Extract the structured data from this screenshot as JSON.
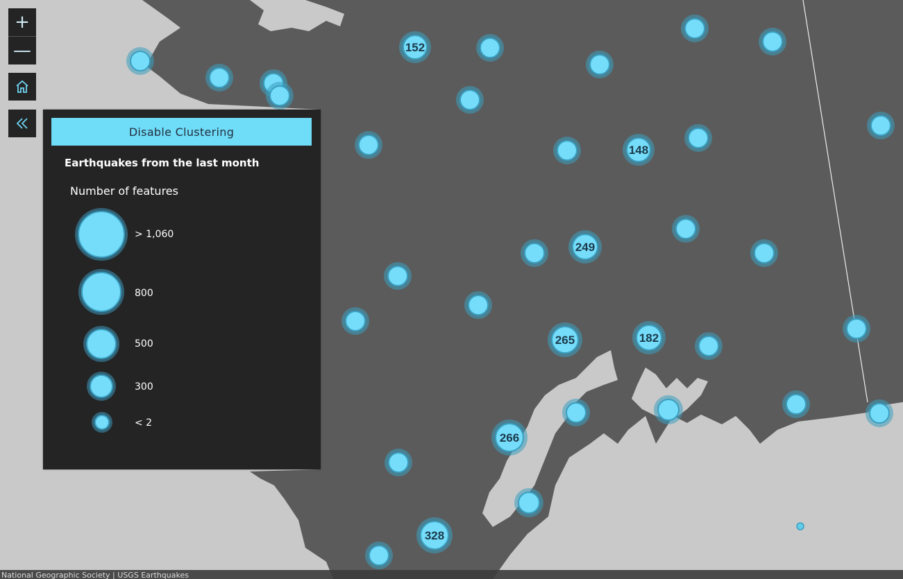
{
  "controls": {
    "zoom_in": "+",
    "zoom_out": "—",
    "home_icon": "home-icon",
    "collapse_icon": "chevron-double-left-icon"
  },
  "panel": {
    "cluster_button": "Disable Clustering",
    "layer_title": "Earthquakes from the last month",
    "legend_heading": "Number of features",
    "legend_items": [
      {
        "label": "> 1,060",
        "count": 1060
      },
      {
        "label": "800",
        "count": 800
      },
      {
        "label": "500",
        "count": 500
      },
      {
        "label": "300",
        "count": 300
      },
      {
        "label": "< 2",
        "count": 2
      }
    ]
  },
  "clusters": {
    "labels": [
      "152",
      "148",
      "249",
      "265",
      "182",
      "266",
      "328"
    ]
  },
  "attribution": "National Geographic Society | USGS Earthquakes",
  "colors": {
    "water": "#c9c9c9",
    "land": "#5b5b5b",
    "panel": "#242424",
    "cluster_fill": "#75dcfa",
    "cluster_halo": "#3a9fc0"
  }
}
